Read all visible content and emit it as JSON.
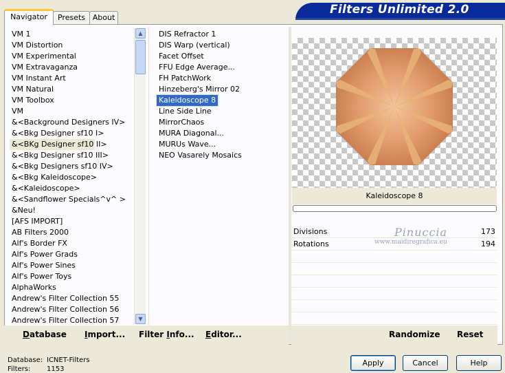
{
  "title": "Filters Unlimited 2.0",
  "tabs": [
    "Navigator",
    "Presets",
    "About"
  ],
  "categories": [
    "VM 1",
    "VM Distortion",
    "VM Experimental",
    "VM Extravaganza",
    "VM Instant Art",
    "VM Natural",
    "VM Toolbox",
    "VM",
    "&<Background Designers IV>",
    "&<Bkg Designer sf10 I>",
    "&<BKg Designer sf10 II>",
    "&<Bkg Designer sf10 III>",
    "&<Bkg Designers sf10 IV>",
    "&<Bkg Kaleidoscope>",
    "&<Kaleidoscope>",
    "&<Sandflower Specials^v^ >",
    "&Neu!",
    "[AFS IMPORT]",
    "AB Filters 2000",
    "Alf's Border FX",
    "Alf's Power Grads",
    "Alf's Power Sines",
    "Alf's Power Toys",
    "AlphaWorks",
    "Andrew's Filter Collection 55",
    "Andrew's Filter Collection 56",
    "Andrew's Filter Collection 57"
  ],
  "selected_category_index": 10,
  "filters": [
    "DIS Refractor 1",
    "DIS Warp (vertical)",
    "Facet Offset",
    "FFU Edge Average...",
    "FH PatchWork",
    "Hinzeberg's Mirror 02",
    "Kaleidoscope 8",
    "Line Side Line",
    "MirrorChaos",
    "MURA Diagonal...",
    "MURUs Wave...",
    "NEO Vasarely Mosaics"
  ],
  "selected_filter_index": 6,
  "preview_label": "Kaleidoscope 8",
  "progress": 0,
  "params": [
    {
      "label": "Divisions",
      "value": "173"
    },
    {
      "label": "Rotations",
      "value": "194"
    }
  ],
  "watermark": {
    "name": "Pinuccia",
    "url": "www.maidiregrafica.eu"
  },
  "toolbar": {
    "database": "Database",
    "import": "Import...",
    "filter_info": "Filter Info...",
    "editor": "Editor...",
    "randomize": "Randomize",
    "reset": "Reset"
  },
  "status": {
    "database_label": "Database:",
    "database_value": "ICNET-Filters",
    "filters_label": "Filters:",
    "filters_value": "1153"
  },
  "buttons": {
    "apply": "Apply",
    "cancel": "Cancel",
    "help": "Help"
  },
  "colors": {
    "banner": "#0a2a9a",
    "selection": "#316ac5",
    "tab_accent": "#ffc83c"
  }
}
